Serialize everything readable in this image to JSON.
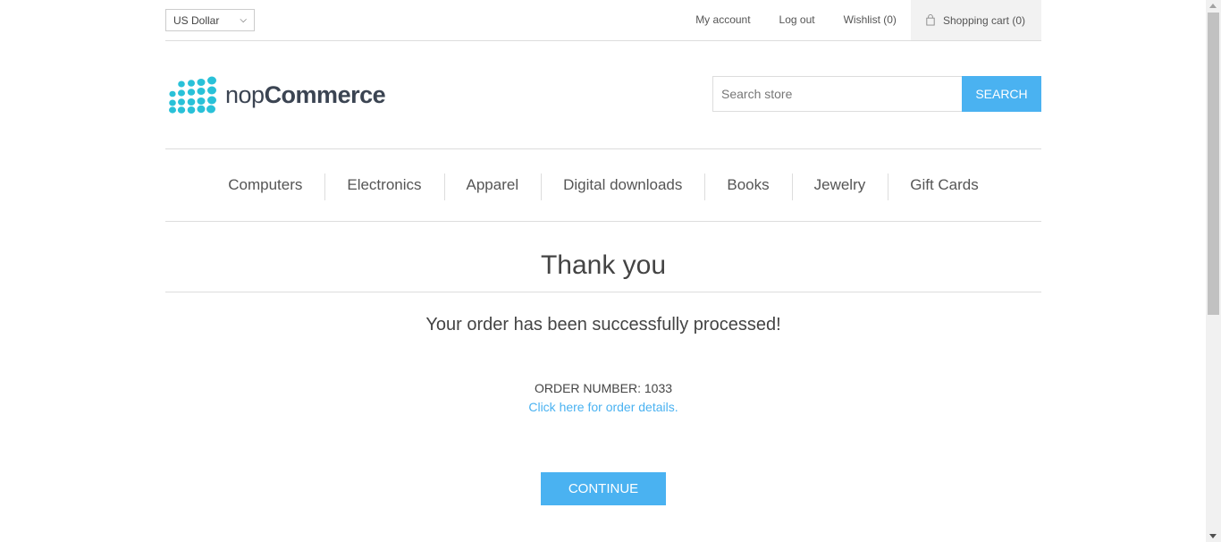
{
  "header": {
    "currency": "US Dollar",
    "links": {
      "my_account": "My account",
      "log_out": "Log out",
      "wishlist": "Wishlist (0)",
      "shopping_cart": "Shopping cart (0)"
    }
  },
  "logo": {
    "part1": "nop",
    "part2": "Commerce"
  },
  "search": {
    "placeholder": "Search store",
    "button": "SEARCH"
  },
  "menu": [
    "Computers",
    "Electronics",
    "Apparel",
    "Digital downloads",
    "Books",
    "Jewelry",
    "Gift Cards"
  ],
  "content": {
    "title": "Thank you",
    "success_message": "Your order has been successfully processed!",
    "order_number": "ORDER NUMBER: 1033",
    "order_details_link": "Click here for order details.",
    "continue_button": "CONTINUE"
  },
  "colors": {
    "accent": "#4ab2f1",
    "logo_dots": "#29c1d8"
  }
}
